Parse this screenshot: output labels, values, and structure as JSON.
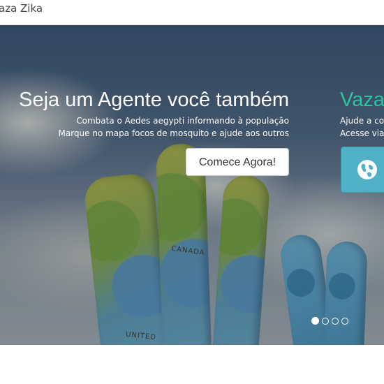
{
  "header": {
    "brand": "aza Zika"
  },
  "carousel": {
    "slides": [
      {
        "title": "Seja um Agente você também",
        "line1": "Combata o Aedes aegypti informando à população",
        "line2": "Marque no mapa focos de mosquito e ajude aos outros",
        "button": "Comece Agora!"
      },
      {
        "title": "Vaza",
        "line1": "Ajude a co",
        "line2": "Acesse via",
        "icon": "globe-icon"
      }
    ],
    "indicator_count": 4,
    "active_indicator": 1
  },
  "map_labels": {
    "canada": "CANADA",
    "united": "UNITED"
  },
  "colors": {
    "accent_green": "#2ec4a0",
    "tile_blue": "#4fb0c6",
    "button_bg": "#ffffff"
  }
}
